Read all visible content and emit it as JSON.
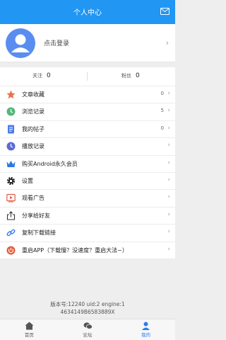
{
  "header": {
    "title": "个人中心",
    "mail_icon": "mail-icon"
  },
  "profile": {
    "login_text": "点击登录",
    "avatar_icon": "user-avatar-icon"
  },
  "stats": {
    "follow_label": "关注",
    "follow_count": "0",
    "fans_label": "粉丝",
    "fans_count": "0"
  },
  "menu": [
    {
      "label": "文章收藏",
      "count": "0",
      "icon": "star-icon",
      "color": "#e8734a"
    },
    {
      "label": "浏览记录",
      "count": "5",
      "icon": "clock-icon",
      "color": "#55b77a"
    },
    {
      "label": "我的帖子",
      "count": "0",
      "icon": "document-icon",
      "color": "#4a7be8"
    },
    {
      "label": "播放记录",
      "count": "",
      "icon": "history-icon",
      "color": "#5b6bd6"
    },
    {
      "label": "购买Android永久会员",
      "count": "",
      "icon": "crown-icon",
      "color": "#2d78e6"
    },
    {
      "label": "设置",
      "count": "",
      "icon": "gear-icon",
      "color": "#111111"
    },
    {
      "label": "观看广告",
      "count": "",
      "icon": "video-icon",
      "color": "#e05a4a"
    },
    {
      "label": "分享给好友",
      "count": "",
      "icon": "share-icon",
      "color": "#333333"
    },
    {
      "label": "复制下载链接",
      "count": "",
      "icon": "link-icon",
      "color": "#2d78e6"
    },
    {
      "label": "重启APP（下载慢？没速度？重启大法~）",
      "count": "",
      "icon": "power-icon",
      "color": "#e0603c"
    }
  ],
  "version": {
    "line1": "版本号:12240 uid:2 engine:1",
    "line2": "4634149B6583889X"
  },
  "tabbar": [
    {
      "label": "首页",
      "icon": "home-icon",
      "active": false
    },
    {
      "label": "论坛",
      "icon": "forum-icon",
      "active": false
    },
    {
      "label": "我的",
      "icon": "profile-icon",
      "active": true
    }
  ],
  "colors": {
    "primary": "#2196f3",
    "tab_active": "#2b7cf0"
  }
}
